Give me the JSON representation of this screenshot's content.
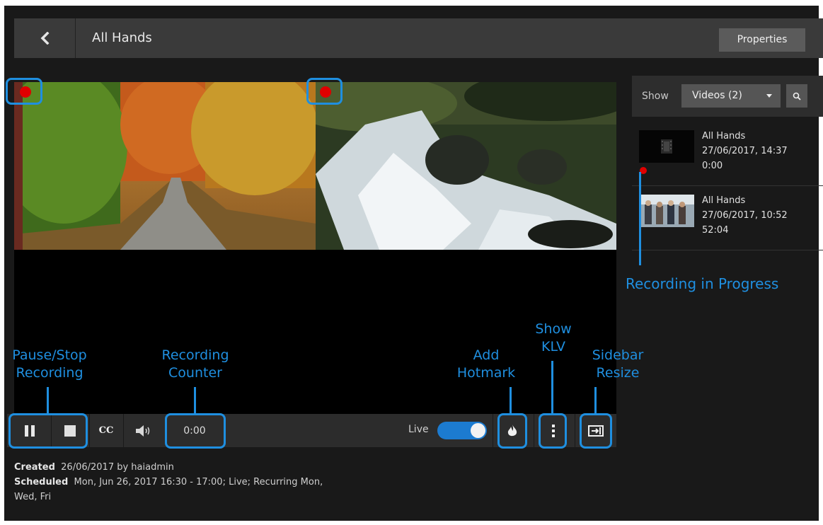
{
  "header": {
    "title": "All Hands",
    "properties_label": "Properties"
  },
  "controls": {
    "cc_label": "CC",
    "counter": "0:00",
    "live_label": "Live"
  },
  "meta": {
    "created_label": "Created",
    "created_value": "26/06/2017 by haiadmin",
    "scheduled_label": "Scheduled",
    "scheduled_value_line1": "Mon, Jun 26, 2017 16:30 - 17:00; Live; Recurring Mon,",
    "scheduled_value_line2": "Wed, Fri"
  },
  "sidebar": {
    "show_label": "Show",
    "select_value": "Videos (2)",
    "items": [
      {
        "title": "All Hands",
        "date": "27/06/2017, 14:37",
        "duration": "0:00",
        "recording": true
      },
      {
        "title": "All Hands",
        "date": "27/06/2017, 10:52",
        "duration": "52:04",
        "recording": false
      }
    ]
  },
  "annotations": {
    "recording_progress": "Recording in Progress",
    "pause_stop_1": "Pause/Stop",
    "pause_stop_2": "Recording",
    "counter_1": "Recording",
    "counter_2": "Counter",
    "hotmark_1": "Add",
    "hotmark_2": "Hotmark",
    "klv_1": "Show",
    "klv_2": "KLV",
    "sidebar_1": "Sidebar",
    "sidebar_2": "Resize"
  },
  "colors": {
    "accent": "#1f8fe0",
    "record": "#e00000",
    "toggle": "#1c7bd0"
  }
}
